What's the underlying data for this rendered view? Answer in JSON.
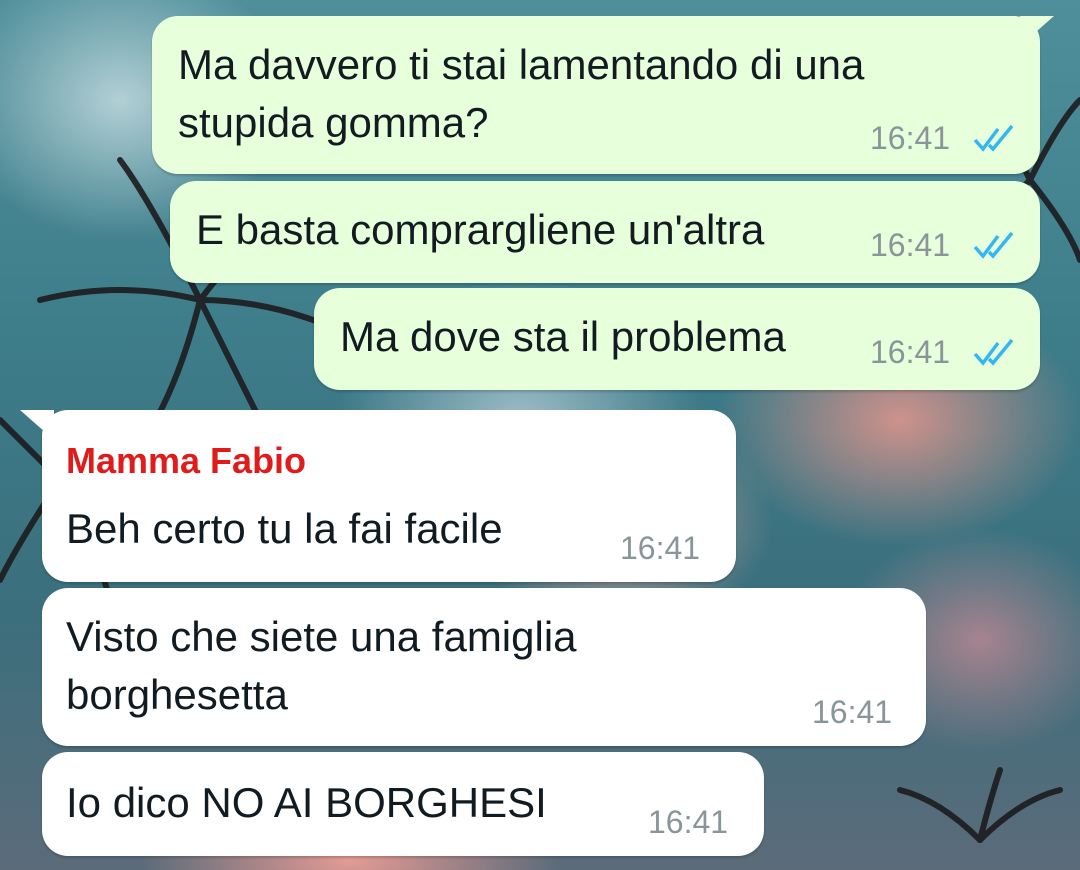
{
  "colors": {
    "outgoing_bubble": "#e7ffdb",
    "incoming_bubble": "#ffffff",
    "sender_name": "#e01b1b",
    "read_ticks": "#34b7f1",
    "timestamp": "#8a9599"
  },
  "messages": [
    {
      "direction": "outgoing",
      "lines": [
        "Ma davvero ti stai lamentando di una",
        "stupida gomma?"
      ],
      "time": "16:41",
      "status_icon": "double-check-read-icon"
    },
    {
      "direction": "outgoing",
      "lines": [
        "E basta comprargliene un'altra"
      ],
      "time": "16:41",
      "status_icon": "double-check-read-icon"
    },
    {
      "direction": "outgoing",
      "lines": [
        "Ma dove sta il problema"
      ],
      "time": "16:41",
      "status_icon": "double-check-read-icon"
    },
    {
      "direction": "incoming",
      "sender": "Mamma Fabio",
      "lines": [
        "Beh certo tu la fai facile"
      ],
      "time": "16:41"
    },
    {
      "direction": "incoming",
      "lines": [
        "Visto che siete una famiglia",
        "borghesetta"
      ],
      "time": "16:41"
    },
    {
      "direction": "incoming",
      "lines": [
        "Io dico NO AI BORGHESI"
      ],
      "time": "16:41"
    }
  ]
}
